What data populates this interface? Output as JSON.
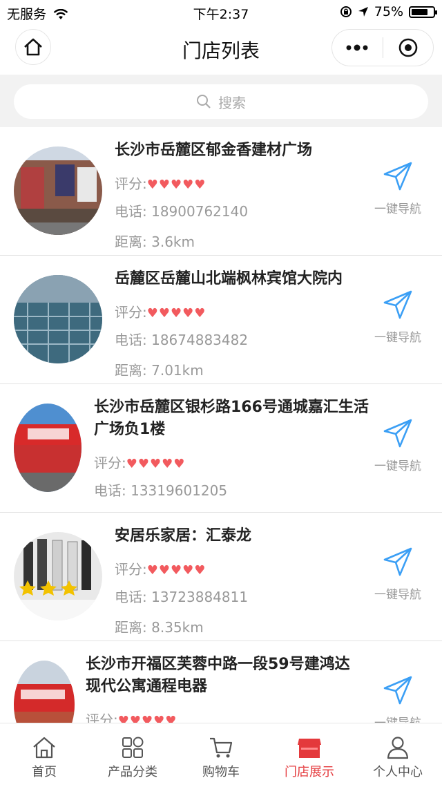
{
  "statusbar": {
    "carrier": "无服务",
    "time": "下午2:37",
    "battery": "75%",
    "battery_level": 0.75
  },
  "header": {
    "title": "门店列表"
  },
  "search": {
    "placeholder": "搜索"
  },
  "labels": {
    "rating": "评分:",
    "phone": "电话: ",
    "distance": "距离: ",
    "navigate": "一键导航"
  },
  "colors": {
    "accent": "#e4393c",
    "heart": "#f25a5e",
    "nav_icon": "#3b9ff5"
  },
  "stores": [
    {
      "name": "长沙市岳麓区郁金香建材广场",
      "rating": 5,
      "rating_text": "♥♥♥♥♥",
      "phone": "18900762140",
      "distance": "3.6km"
    },
    {
      "name": "岳麓区岳麓山北端枫林宾馆大院内",
      "rating": 5,
      "rating_text": "♥♥♥♥♥",
      "phone": "18674883482",
      "distance": "7.01km"
    },
    {
      "name": "长沙市岳麓区银杉路166号通城嘉汇生活广场负1楼",
      "rating": 5,
      "rating_text": "♥♥♥♥♥",
      "phone": "13319601205"
    },
    {
      "name": "安居乐家居：汇泰龙",
      "rating": 5,
      "rating_text": "♥♥♥♥♥",
      "phone": "13723884811",
      "distance": "8.35km"
    },
    {
      "name": "长沙市开福区芙蓉中路一段59号建鸿达现代公寓通程电器",
      "rating": 5,
      "rating_text": "♥♥♥♥♥"
    }
  ],
  "tabs": [
    {
      "label": "首页",
      "icon": "home-icon"
    },
    {
      "label": "产品分类",
      "icon": "category-icon"
    },
    {
      "label": "购物车",
      "icon": "cart-icon"
    },
    {
      "label": "门店展示",
      "icon": "store-icon",
      "active": true
    },
    {
      "label": "个人中心",
      "icon": "user-icon"
    }
  ]
}
